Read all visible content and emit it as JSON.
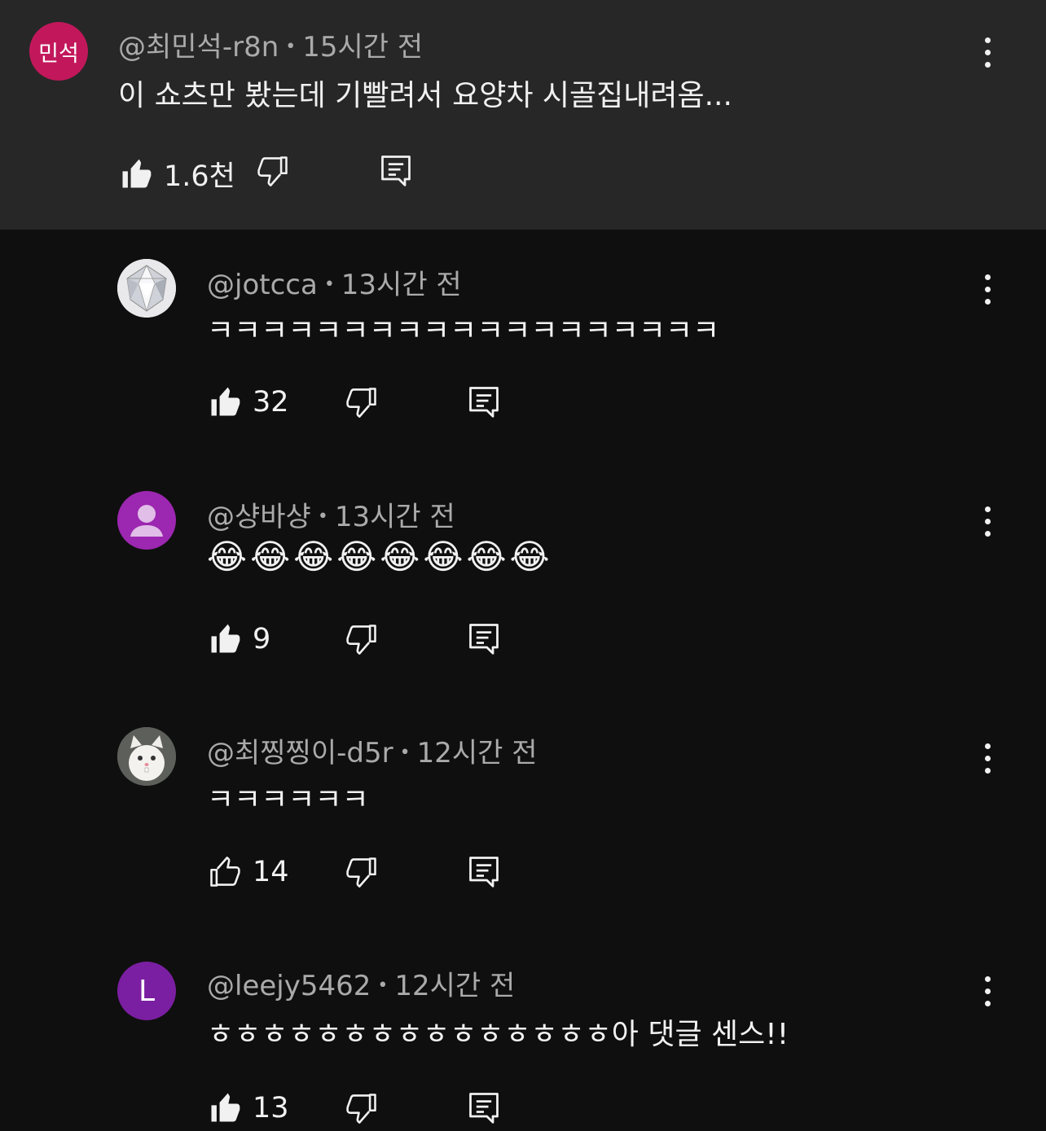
{
  "colors": {
    "parent_bg": "#272727",
    "page_bg": "#0f0f0f",
    "meta_text": "#aaaaaa",
    "text": "#f1f1f1"
  },
  "parent_comment": {
    "avatar_text": "민석",
    "avatar_color": "#c2185b",
    "author": "@최민석-r8n",
    "time": "15시간 전",
    "text": "이 쇼츠만 봤는데 기빨려서 요양차 시골집내려옴...",
    "likes": "1.6천",
    "liked": true
  },
  "replies": [
    {
      "author": "@jotcca",
      "time": "13시간 전",
      "text": "ㅋㅋㅋㅋㅋㅋㅋㅋㅋㅋㅋㅋㅋㅋㅋㅋㅋㅋㅋ",
      "likes": "32",
      "liked": true,
      "avatar_icon": "diamond-avatar-icon"
    },
    {
      "author": "@샹바샹",
      "time": "13시간 전",
      "text": "😂😂😂😂😂😂😂😂",
      "likes": "9",
      "liked": true,
      "avatar_icon": "default-person-avatar-icon",
      "avatar_color": "#9c27b0"
    },
    {
      "author": "@최찡찡이-d5r",
      "time": "12시간 전",
      "text": "ㅋㅋㅋㅋㅋㅋ",
      "likes": "14",
      "liked": false,
      "avatar_icon": "white-cat-avatar-icon"
    },
    {
      "author": "@leejy5462",
      "time": "12시간 전",
      "text": "ㅎㅎㅎㅎㅎㅎㅎㅎㅎㅎㅎㅎㅎㅎㅎ아 댓글 센스!!",
      "likes": "13",
      "liked": true,
      "avatar_text": "L",
      "avatar_color": "#7b1fa2"
    }
  ],
  "dot_separator": "•"
}
